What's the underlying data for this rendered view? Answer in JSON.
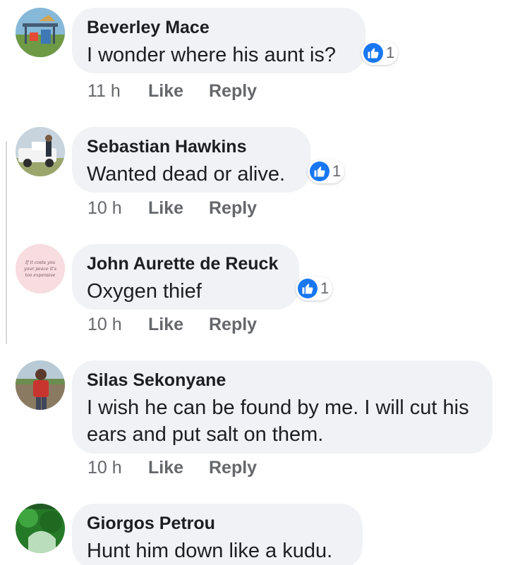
{
  "comments": [
    {
      "author": "Beverley Mace",
      "text": "I wonder where his aunt is?",
      "avatar_icon": "playground-photo-icon",
      "reaction_icon": "like-icon",
      "reaction_count": "1",
      "time": "11 h",
      "like_label": "Like",
      "reply_label": "Reply"
    },
    {
      "author": "Sebastian Hawkins",
      "text": "Wanted dead or alive.",
      "avatar_icon": "truck-photo-icon",
      "reaction_icon": "like-icon",
      "reaction_count": "1",
      "time": "10 h",
      "like_label": "Like",
      "reply_label": "Reply"
    },
    {
      "author": "John  Aurette de Reuck",
      "text": "Oxygen thief",
      "avatar_icon": "handwritten-quote-icon",
      "avatar_text": "If it costs you your peace it's too expensive",
      "reaction_icon": "like-icon",
      "reaction_count": "1",
      "time": "10 h",
      "like_label": "Like",
      "reply_label": "Reply"
    },
    {
      "author": "Silas Sekonyane",
      "text": "I wish he can be found by me. I will cut his ears and put salt on them.",
      "avatar_icon": "person-photo-icon",
      "time": "10 h",
      "like_label": "Like",
      "reply_label": "Reply"
    },
    {
      "author": "Giorgos Petrou",
      "text": "Hunt him down like a kudu.",
      "avatar_icon": "green-photo-icon"
    }
  ],
  "colors": {
    "bubble": "#f0f2f5",
    "like_blue": "#1877f2",
    "meta_gray": "#65676b",
    "text": "#1c1e21"
  }
}
